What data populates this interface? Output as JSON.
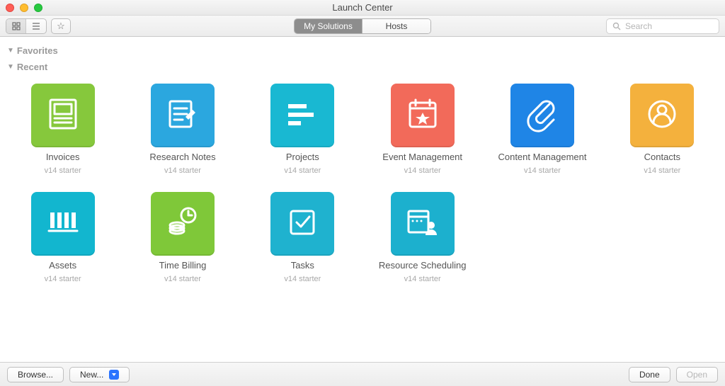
{
  "window": {
    "title": "Launch Center"
  },
  "toolbar": {
    "tabs": {
      "solutions": "My Solutions",
      "hosts": "Hosts",
      "active": "solutions"
    },
    "search_placeholder": "Search"
  },
  "sections": {
    "favorites_label": "Favorites",
    "recent_label": "Recent"
  },
  "recent": [
    {
      "title": "Invoices",
      "sub": "v14 starter",
      "color": "green1",
      "icon": "invoice"
    },
    {
      "title": "Research Notes",
      "sub": "v14 starter",
      "color": "blue1",
      "icon": "notes"
    },
    {
      "title": "Projects",
      "sub": "v14 starter",
      "color": "cyan1",
      "icon": "projects"
    },
    {
      "title": "Event Management",
      "sub": "v14 starter",
      "color": "red1",
      "icon": "event"
    },
    {
      "title": "Content Management",
      "sub": "v14 starter",
      "color": "blue2",
      "icon": "clip"
    },
    {
      "title": "Contacts",
      "sub": "v14 starter",
      "color": "orange1",
      "icon": "contact"
    },
    {
      "title": "Assets",
      "sub": "v14 starter",
      "color": "cyan2",
      "icon": "assets"
    },
    {
      "title": "Time Billing",
      "sub": "v14 starter",
      "color": "green2",
      "icon": "time"
    },
    {
      "title": "Tasks",
      "sub": "v14 starter",
      "color": "cyan3",
      "icon": "tasks"
    },
    {
      "title": "Resource Scheduling",
      "sub": "v14 starter",
      "color": "teal1",
      "icon": "resource"
    }
  ],
  "footer": {
    "browse": "Browse...",
    "new": "New...",
    "done": "Done",
    "open": "Open"
  }
}
